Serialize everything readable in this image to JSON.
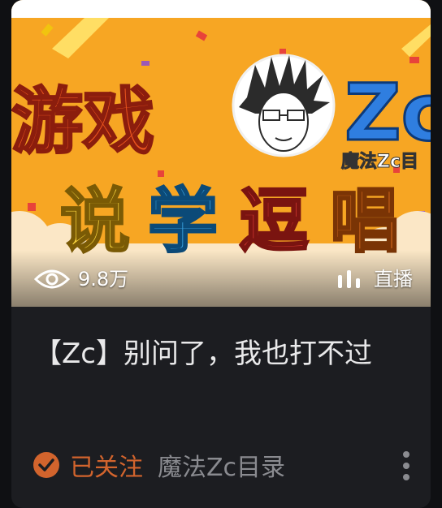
{
  "thumbnail": {
    "banner_title": "游戏",
    "logo_text": "Zc",
    "logo_subtitle": "魔法Zc目",
    "slogan_chars": [
      "说",
      "学",
      "逗",
      "唱"
    ],
    "view_count": "9.8万",
    "live_label": "直播"
  },
  "video": {
    "title": "【Zc】别问了，我也打不过"
  },
  "meta": {
    "follow_status": "已关注",
    "channel_name": "魔法Zc目录"
  },
  "colors": {
    "follow_accent": "#d2642d",
    "thumbnail_bg": "#f7a623",
    "card_bg": "#1c1d21"
  },
  "icons": [
    "eye-icon",
    "live-bars-icon",
    "checkmark-badge-icon",
    "more-vertical-icon"
  ]
}
